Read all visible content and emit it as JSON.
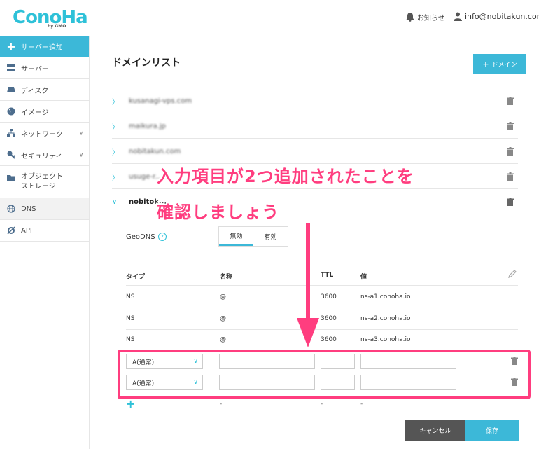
{
  "header": {
    "logo": "ConoHa",
    "logo_sub": "by GMO",
    "notice_label": "お知らせ",
    "account_email": "info@nobitakun.com"
  },
  "sidebar": {
    "items": [
      {
        "label": "サーバー追加",
        "icon": "plus-icon"
      },
      {
        "label": "サーバー",
        "icon": "server-icon"
      },
      {
        "label": "ディスク",
        "icon": "disk-icon"
      },
      {
        "label": "イメージ",
        "icon": "globe-icon"
      },
      {
        "label": "ネットワーク",
        "icon": "network-icon"
      },
      {
        "label": "セキュリティ",
        "icon": "key-icon"
      },
      {
        "label": "オブジェクト\nストレージ",
        "label_line1": "オブジェクト",
        "label_line2": "ストレージ",
        "icon": "folder-icon"
      },
      {
        "label": "DNS",
        "icon": "dns-globe-icon"
      },
      {
        "label": "API",
        "icon": "api-icon"
      }
    ]
  },
  "main": {
    "title": "ドメインリスト",
    "add_domain_label": "ドメイン",
    "domains": [
      {
        "name": "kusanagi-vps.com"
      },
      {
        "name": "maikura.jp"
      },
      {
        "name": "nobitakun.com"
      },
      {
        "name": "usuge-r..."
      },
      {
        "name": "nobitok..."
      }
    ],
    "geodns": {
      "label": "GeoDNS",
      "options": [
        "無効",
        "有効"
      ],
      "selected": "無効"
    },
    "table": {
      "headers": {
        "type": "タイプ",
        "name": "名称",
        "ttl": "TTL",
        "value": "値"
      },
      "rows": [
        {
          "type": "NS",
          "name": "@",
          "ttl": "3600",
          "value": "ns-a1.conoha.io"
        },
        {
          "type": "NS",
          "name": "@",
          "ttl": "3600",
          "value": "ns-a2.conoha.io"
        },
        {
          "type": "NS",
          "name": "@",
          "ttl": "3600",
          "value": "ns-a3.conoha.io"
        }
      ],
      "new_rows": [
        {
          "type": "A(通常)"
        },
        {
          "type": "A(通常)"
        }
      ],
      "add_row_dash": "-"
    },
    "cancel_label": "キャンセル",
    "save_label": "保存"
  },
  "annotation": {
    "line1": "入力項目が2つ追加されたことを",
    "line2": "確認しましょう",
    "color": "#ff3d7f"
  },
  "colors": {
    "accent": "#3cb8d8",
    "annotation": "#ff3d7f"
  }
}
